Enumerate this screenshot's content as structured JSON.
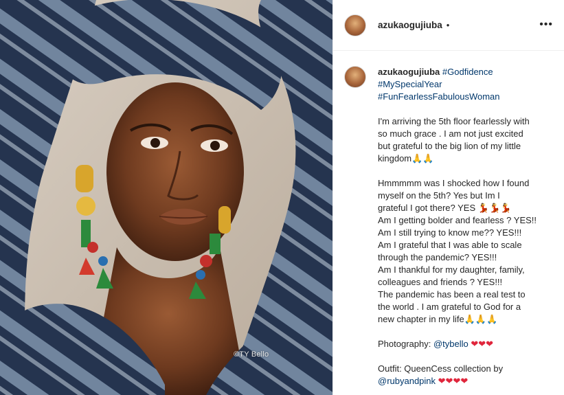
{
  "photo": {
    "watermark": "©TY Bello"
  },
  "post_header": {
    "username": "azukaogujiuba",
    "separator": "•",
    "more_label": "•••"
  },
  "caption": {
    "username": "azukaogujiuba",
    "hashtags": [
      "#Godfidence",
      "#MySpecialYear",
      "#FunFearlessFabulousWoman"
    ],
    "paragraph1": [
      "I'm arriving the 5th floor fearlessly with",
      "so much grace . I am not just excited",
      "but grateful to the big lion of my little",
      "kingdom"
    ],
    "paragraph1_emoji": "🙏🙏",
    "paragraph2": [
      "Hmmmmm was I shocked how I found",
      "myself on the 5th? Yes but Im I",
      "grateful I got there? YES",
      "Am I getting bolder and fearless ? YES!!",
      "Am I still trying to know me?? YES!!!",
      "Am I grateful that I was able to scale",
      "through the pandemic? YES!!!",
      "Am I thankful for my daughter, family,",
      "colleagues and friends ? YES!!!",
      "The pandemic has been a real test to",
      "the world . I am grateful to God for a",
      "new chapter in my life"
    ],
    "dancers_emoji": "💃💃💃",
    "chapter_emoji": "🙏🙏🙏",
    "photography_label": "Photography:",
    "photography_handle": "@tybello",
    "hearts3": "❤❤❤",
    "outfit_label": "Outfit: QueenCess collection by",
    "outfit_handle": "@rubyandpink",
    "hearts4": "❤❤❤❤"
  }
}
